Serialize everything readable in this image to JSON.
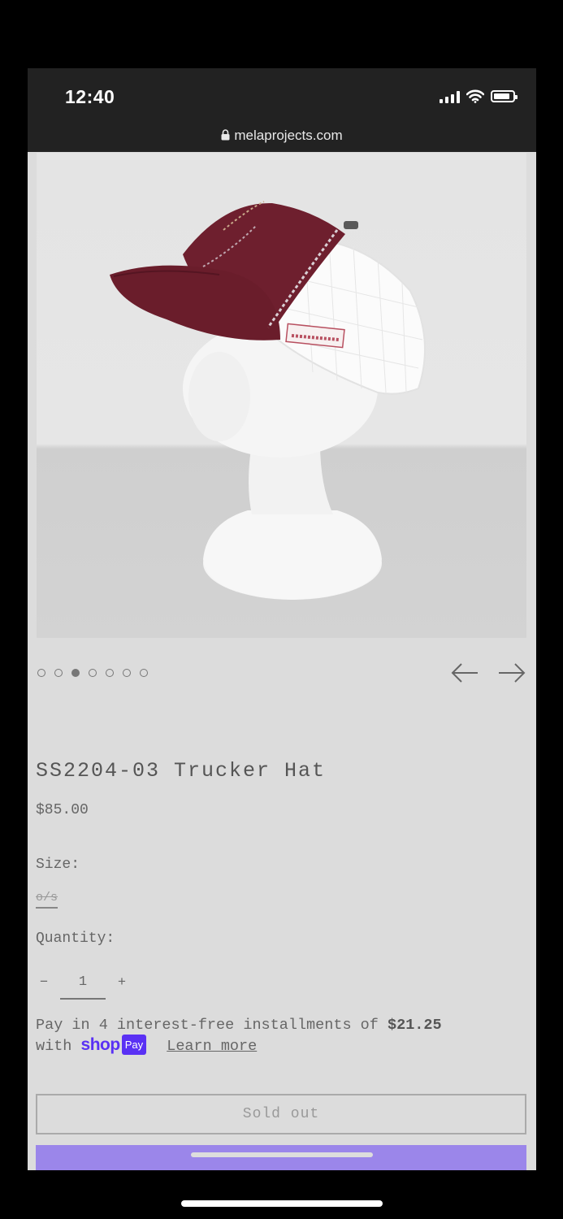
{
  "status_bar": {
    "time": "12:40",
    "url": "melaprojects.com"
  },
  "icons": [
    "lock-icon",
    "signal-icon",
    "wifi-icon",
    "battery-icon",
    "arrow-left-icon",
    "arrow-right-icon"
  ],
  "gallery": {
    "total_slides": 7,
    "active_index": 2
  },
  "product": {
    "title": "SS2204-03 Trucker Hat",
    "price": "$85.00",
    "size_label": "Size:",
    "size_option": "o/s",
    "quantity_label": "Quantity:",
    "quantity_minus": "−",
    "quantity_value": "1",
    "quantity_plus": "+"
  },
  "installments": {
    "prefix": "Pay in 4 interest-free installments of",
    "amount": "$21.25",
    "with": "with",
    "shop_word": "shop",
    "pay_badge": "Pay",
    "learn_more": "Learn more"
  },
  "buttons": {
    "sold_out": "Sold out"
  },
  "colors": {
    "shop_pay": "#5a31f4",
    "buy_bar": "#9b86ea",
    "cap": "#6e1f2e"
  }
}
